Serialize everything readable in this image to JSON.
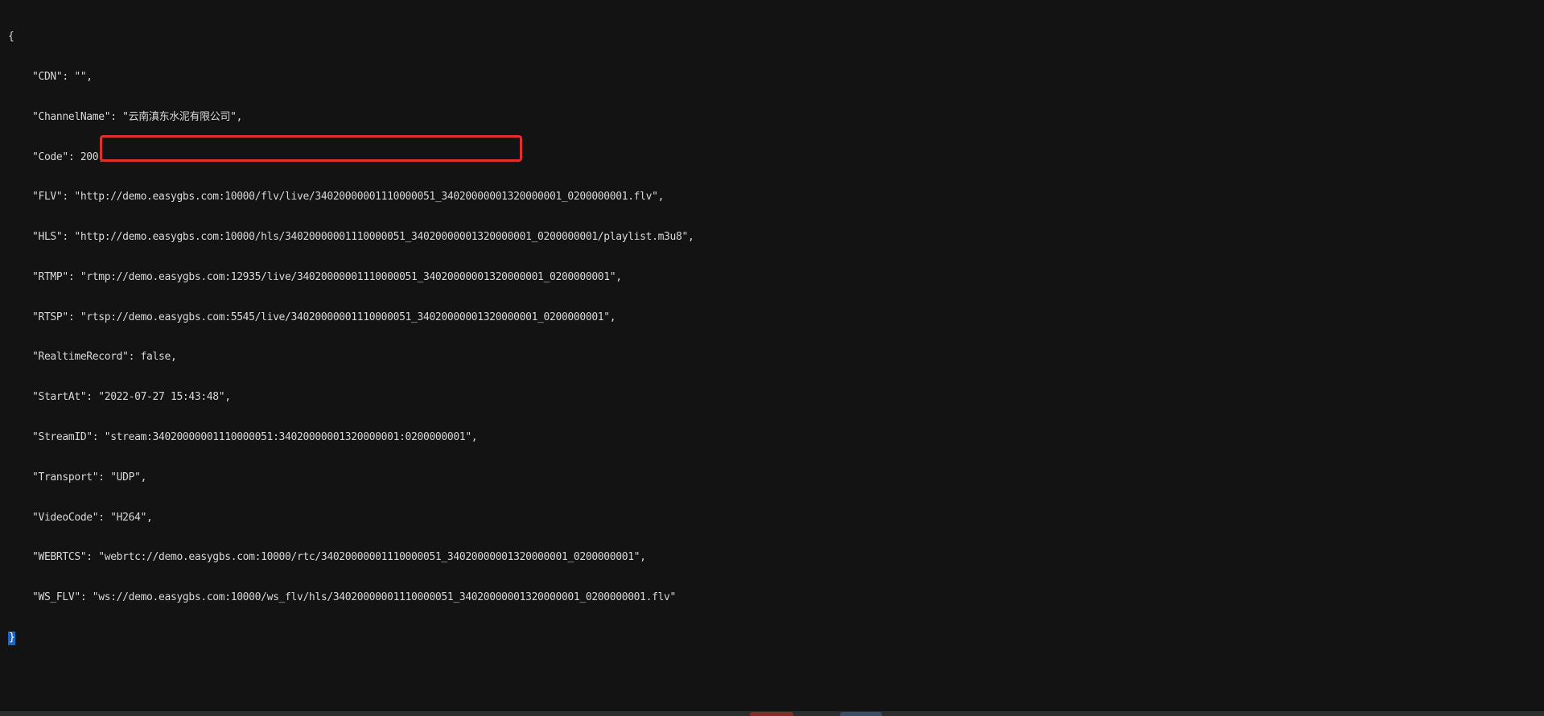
{
  "json_view": {
    "open_brace": "{",
    "close_brace": "}",
    "lines": [
      "\"CDN\": \"\",",
      "\"ChannelName\": \"云南滇东水泥有限公司\",",
      "\"Code\": 200,",
      "\"FLV\": \"http://demo.easygbs.com:10000/flv/live/34020000001110000051_34020000001320000001_0200000001.flv\",",
      "\"HLS\": \"http://demo.easygbs.com:10000/hls/34020000001110000051_34020000001320000001_0200000001/playlist.m3u8\",",
      "\"RTMP\": \"rtmp://demo.easygbs.com:12935/live/34020000001110000051_34020000001320000001_0200000001\",",
      "\"RTSP\": \"rtsp://demo.easygbs.com:5545/live/34020000001110000051_34020000001320000001_0200000001\",",
      "\"RealtimeRecord\": false,",
      "\"StartAt\": \"2022-07-27 15:43:48\",",
      "\"StreamID\": \"stream:34020000001110000051:34020000001320000001:0200000001\",",
      "\"Transport\": \"UDP\",",
      "\"VideoCode\": \"H264\",",
      "\"WEBRTCS\": \"webrtc://demo.easygbs.com:10000/rtc/34020000001110000051_34020000001320000001_0200000001\",",
      "\"WS_FLV\": \"ws://demo.easygbs.com:10000/ws_flv/hls/34020000001110000051_34020000001320000001_0200000001.flv\""
    ]
  },
  "colors": {
    "background": "#131313",
    "text": "#d8d8d8",
    "highlight_box": "#e0302a",
    "selection": "#1f63c6"
  }
}
